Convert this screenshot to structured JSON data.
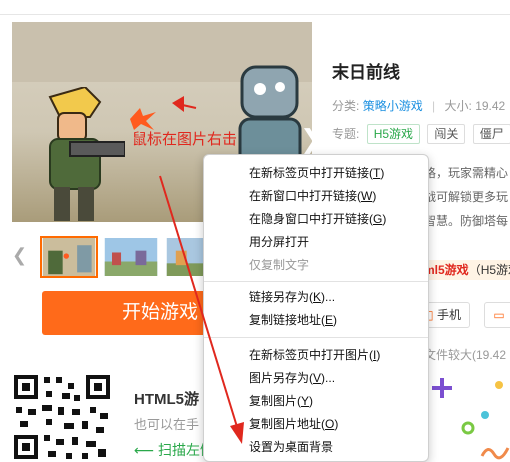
{
  "hero": {
    "hint": "鼠标在图片右击",
    "next_glyph": "❯"
  },
  "thumbs": {
    "prev_glyph": "❮",
    "items": [
      "thumb-1",
      "thumb-2",
      "thumb-3"
    ]
  },
  "start_button": {
    "label": "开始游戏"
  },
  "game": {
    "title": "末日前线",
    "category_label": "分类:",
    "category": "策略小游戏",
    "size_label": "大小:",
    "size": "19.42",
    "topic_label": "专题:",
    "tags": [
      "H5游戏",
      "闯关",
      "僵尸"
    ]
  },
  "description": {
    "line1": "格，玩家需精心",
    "line2": "战可解锁更多玩",
    "line3": "智慧。防御塔每"
  },
  "note": {
    "highlight": "ml5游戏",
    "rest": "（H5游戏"
  },
  "actions": {
    "phone": "手机"
  },
  "size_note": "文件较大(19.42",
  "html5": {
    "title": "HTML5游",
    "subtitle": "也可以在手",
    "scan": "扫描左侧"
  },
  "context_menu": {
    "items": [
      {
        "label": "在新标签页中打开链接",
        "key": "T"
      },
      {
        "label": "在新窗口中打开链接",
        "key": "W"
      },
      {
        "label": "在隐身窗口中打开链接",
        "key": "G"
      },
      {
        "label": "用分屏打开",
        "key": ""
      },
      {
        "label": "仅复制文字",
        "key": ""
      },
      {
        "label": "链接另存为",
        "key": "K",
        "suffix": "..."
      },
      {
        "label": "复制链接地址",
        "key": "E"
      },
      {
        "label": "在新标签页中打开图片",
        "key": "I"
      },
      {
        "label": "图片另存为",
        "key": "V",
        "suffix": "..."
      },
      {
        "label": "复制图片",
        "key": "Y"
      },
      {
        "label": "复制图片地址",
        "key": "O"
      },
      {
        "label": "设置为桌面背景",
        "key": ""
      }
    ]
  },
  "colors": {
    "accent_orange": "#ff6a1a",
    "link_blue": "#1a8fe0",
    "tag_green": "#2aa84a",
    "annotation_red": "#e0281e"
  }
}
